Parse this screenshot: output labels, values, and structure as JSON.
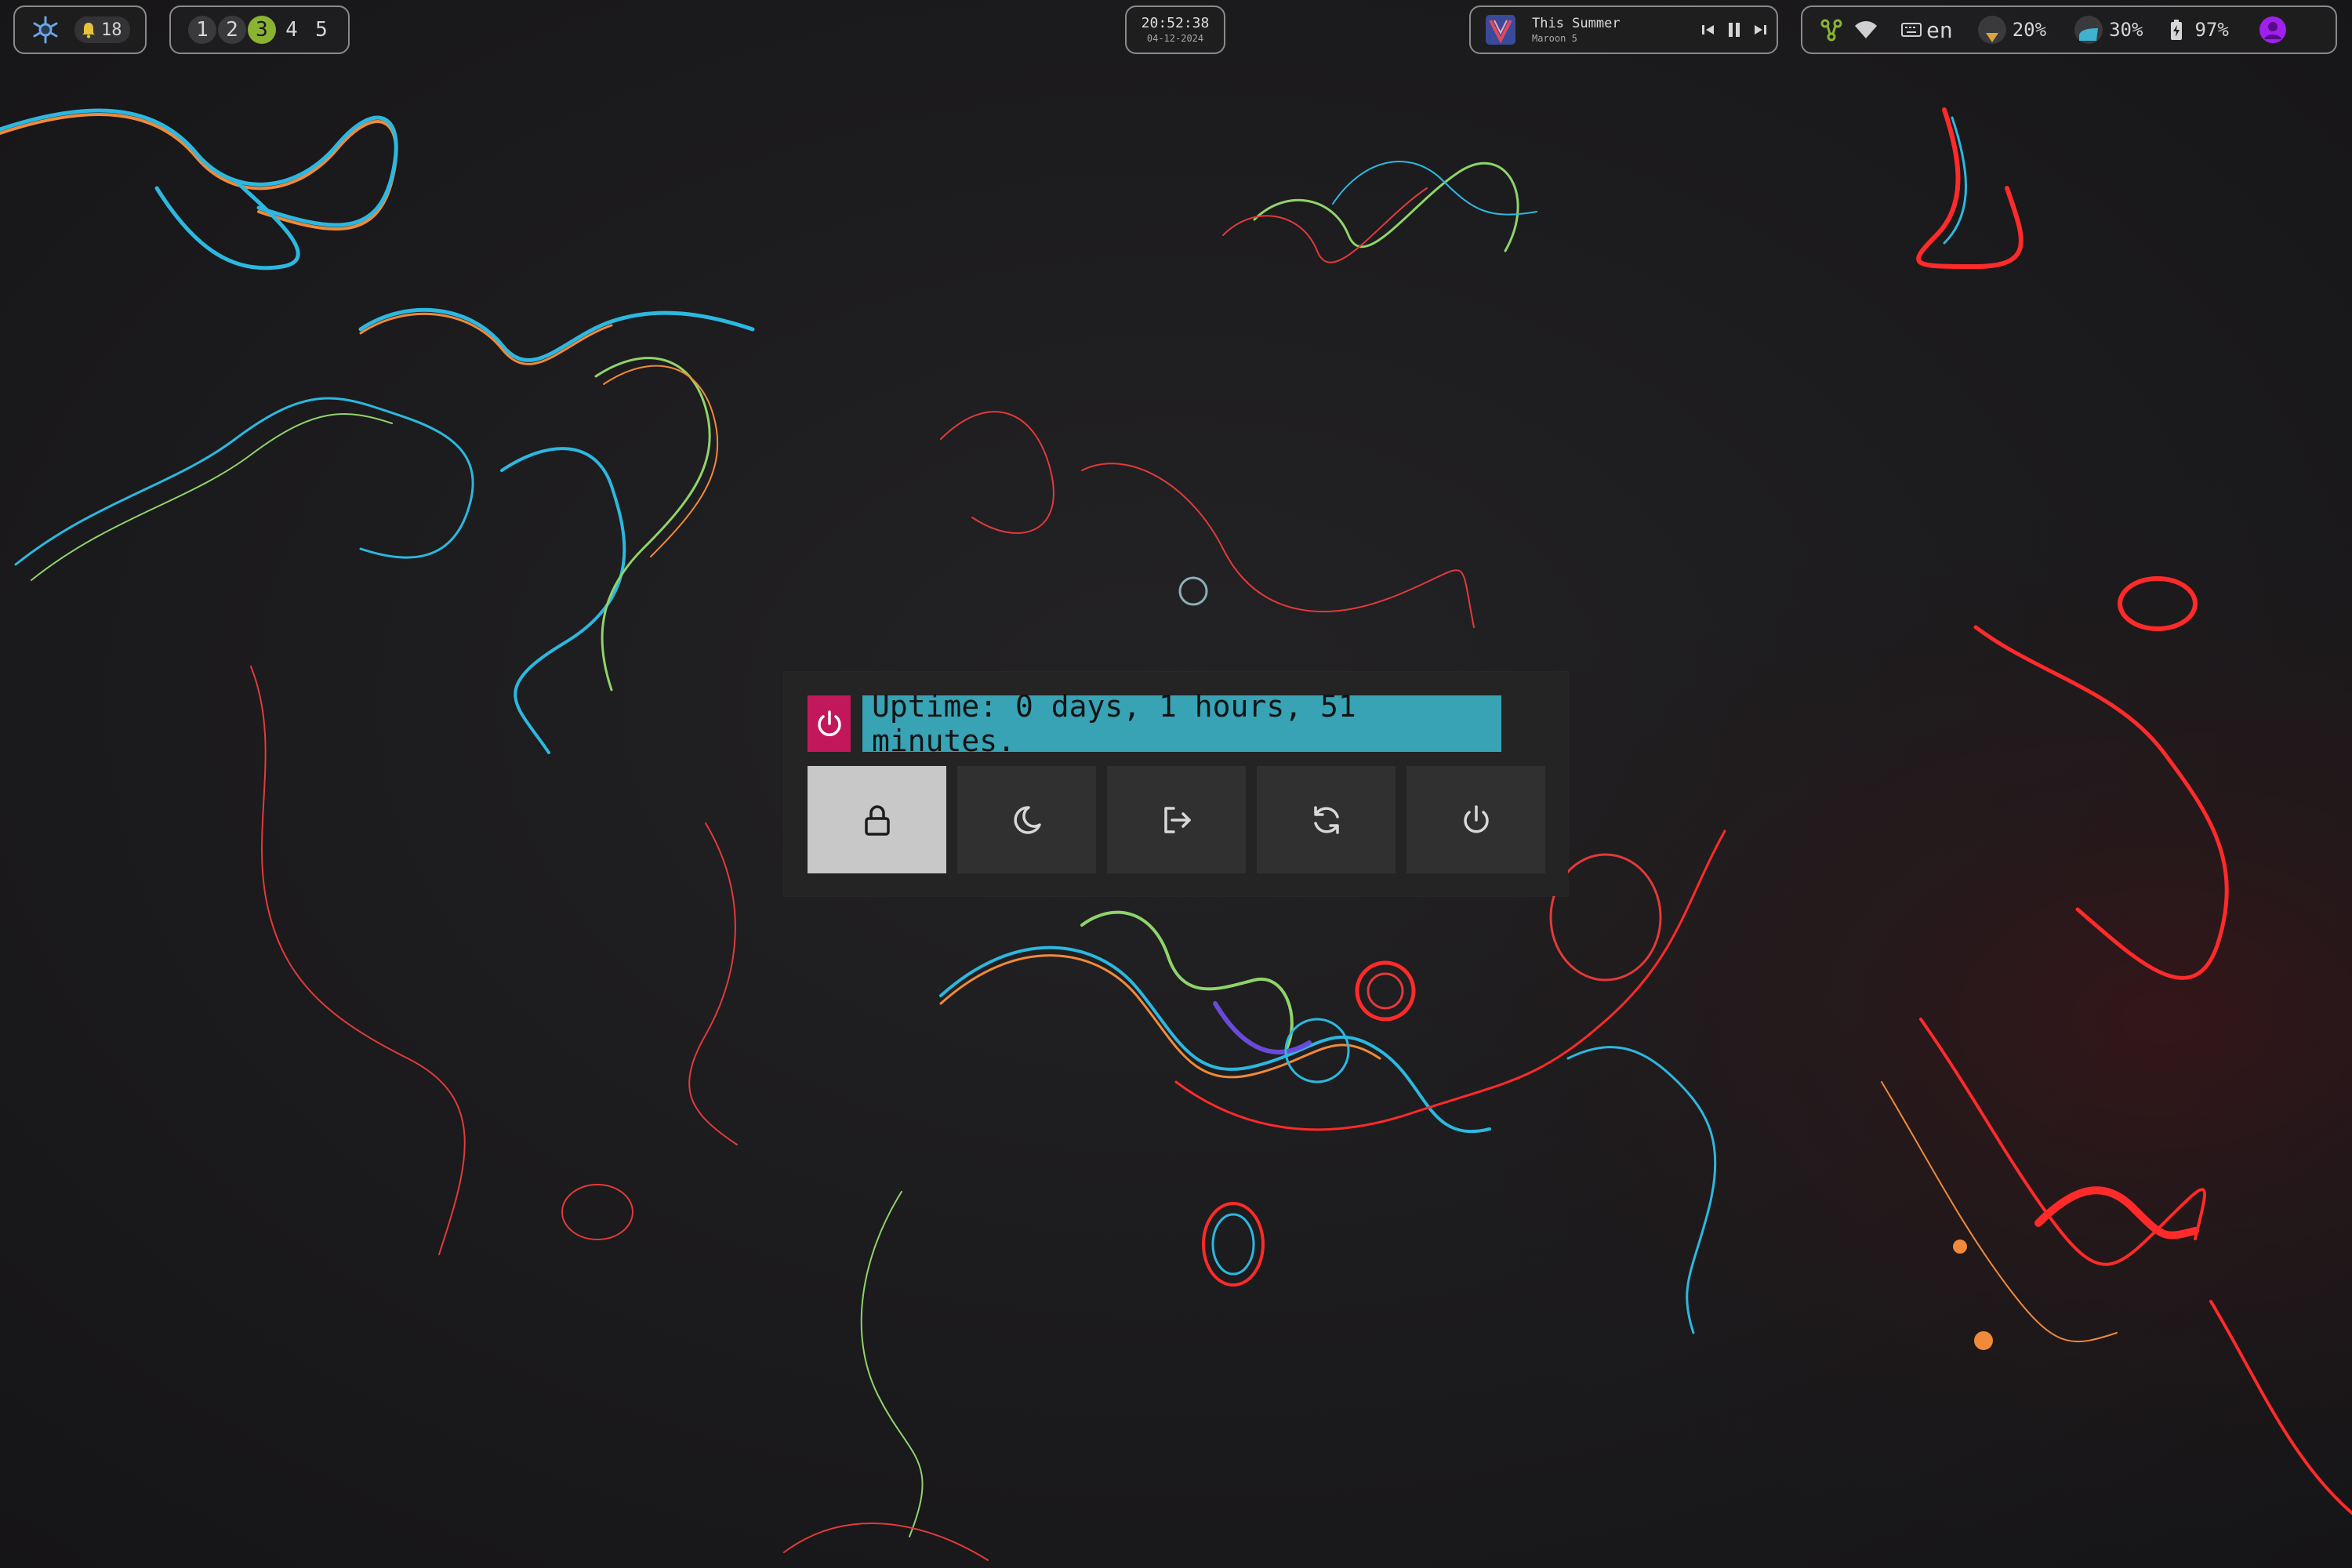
{
  "wallpaper": {
    "colors": [
      "#e23a3a",
      "#2cb8e0",
      "#f08a3a",
      "#8fd46a",
      "#ff2a2a",
      "#6a4ad8"
    ]
  },
  "bar": {
    "launcher": {
      "icon": "gear-snowflake-icon",
      "notification_icon": "bell-icon",
      "notifications": "18"
    },
    "workspaces": [
      {
        "label": "1",
        "state": "occupied"
      },
      {
        "label": "2",
        "state": "occupied"
      },
      {
        "label": "3",
        "state": "active"
      },
      {
        "label": "4",
        "state": "empty"
      },
      {
        "label": "5",
        "state": "empty"
      }
    ],
    "clock": {
      "time": "20:52:38",
      "date": "04-12-2024"
    },
    "media": {
      "title": "This Summer",
      "artist": "Maroon 5",
      "prev_icon": "skip-previous-icon",
      "play_icon": "pause-icon",
      "next_icon": "skip-next-icon"
    },
    "status": {
      "keyboard_layout": "en",
      "brightness": "20%",
      "volume": "30%",
      "battery": "97%",
      "colors": {
        "brightness": "#d9a441",
        "volume": "#3fb2d0",
        "avatar": "#a020f0",
        "accent": "#8ab334"
      }
    }
  },
  "powermenu": {
    "prompt": "Uptime: 0 days, 1 hours, 51 minutes.",
    "badge_icon": "power-icon",
    "badge_color": "#c2185b",
    "prompt_color": "#38a3b5",
    "buttons": [
      {
        "id": "lock",
        "icon": "lock-icon",
        "selected": true
      },
      {
        "id": "suspend",
        "icon": "moon-icon",
        "selected": false
      },
      {
        "id": "logout",
        "icon": "logout-icon",
        "selected": false
      },
      {
        "id": "reboot",
        "icon": "reboot-icon",
        "selected": false
      },
      {
        "id": "shutdown",
        "icon": "power-icon",
        "selected": false
      }
    ]
  }
}
